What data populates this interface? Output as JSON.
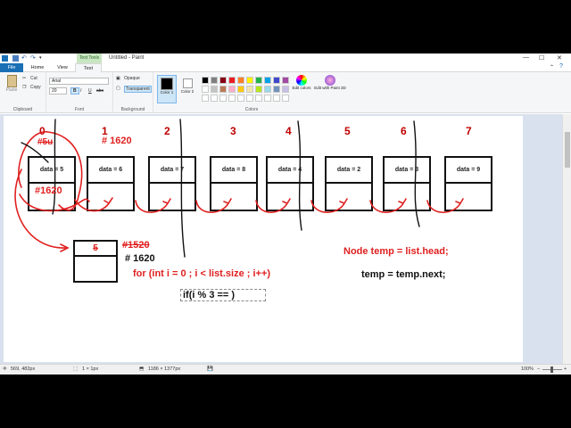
{
  "titlebar": {
    "context_tab": "Text Tools",
    "title": "Untitled - Paint",
    "minimize": "—",
    "maximize": "☐",
    "close": "✕"
  },
  "tabs": [
    "File",
    "Home",
    "View",
    "Text"
  ],
  "ribbon": {
    "clipboard": {
      "label": "Clipboard",
      "paste": "Paste",
      "cut": "Cut",
      "copy": "Copy"
    },
    "font": {
      "label": "Font",
      "family": "Arial",
      "size": "20",
      "bold": "B",
      "italic": "I",
      "underline": "U",
      "strike": "abc"
    },
    "background": {
      "label": "Background",
      "opaque": "Opaque",
      "transparent": "Transparent"
    },
    "colors": {
      "label": "Colors",
      "color1": "Color 1",
      "color2": "Color 2",
      "edit_colors": "Edit colors",
      "paint3d": "Edit with Paint 3D"
    }
  },
  "palette_row1": [
    "#000000",
    "#7f7f7f",
    "#880015",
    "#ed1c24",
    "#ff7f27",
    "#fff200",
    "#22b14c",
    "#00a2e8",
    "#3f48cc",
    "#a349a4"
  ],
  "palette_row2": [
    "#ffffff",
    "#c3c3c3",
    "#b97a57",
    "#ffaec9",
    "#ffc90e",
    "#efe4b0",
    "#b5e61d",
    "#99d9ea",
    "#7092be",
    "#c8bfe7"
  ],
  "canvas": {
    "indices": [
      "0",
      "1",
      "2",
      "3",
      "4",
      "5",
      "6",
      "7"
    ],
    "nodes": [
      "data = 5",
      "data = 6",
      "data = 7",
      "data = 8",
      "data = 4",
      "data = 2",
      "data = 3",
      "data = 9"
    ],
    "addr_top": "# 1620",
    "addr_node0_scribble": "#5u",
    "addr_node0": "#1620",
    "temp_struck_addr": "#1520",
    "temp_addr": "# 1620",
    "temp_struck_digit": "5",
    "for_loop": "for (int i = 0 ; i < list.size ; i++)",
    "if_text": "if(i % 3 == )",
    "node_temp": "Node temp = list.head;",
    "temp_next": "temp = temp.next;"
  },
  "status": {
    "cursor": "569, 482px",
    "selection": "1 × 1px",
    "canvas_size": "1186 × 1377px",
    "zoom": "100%"
  }
}
